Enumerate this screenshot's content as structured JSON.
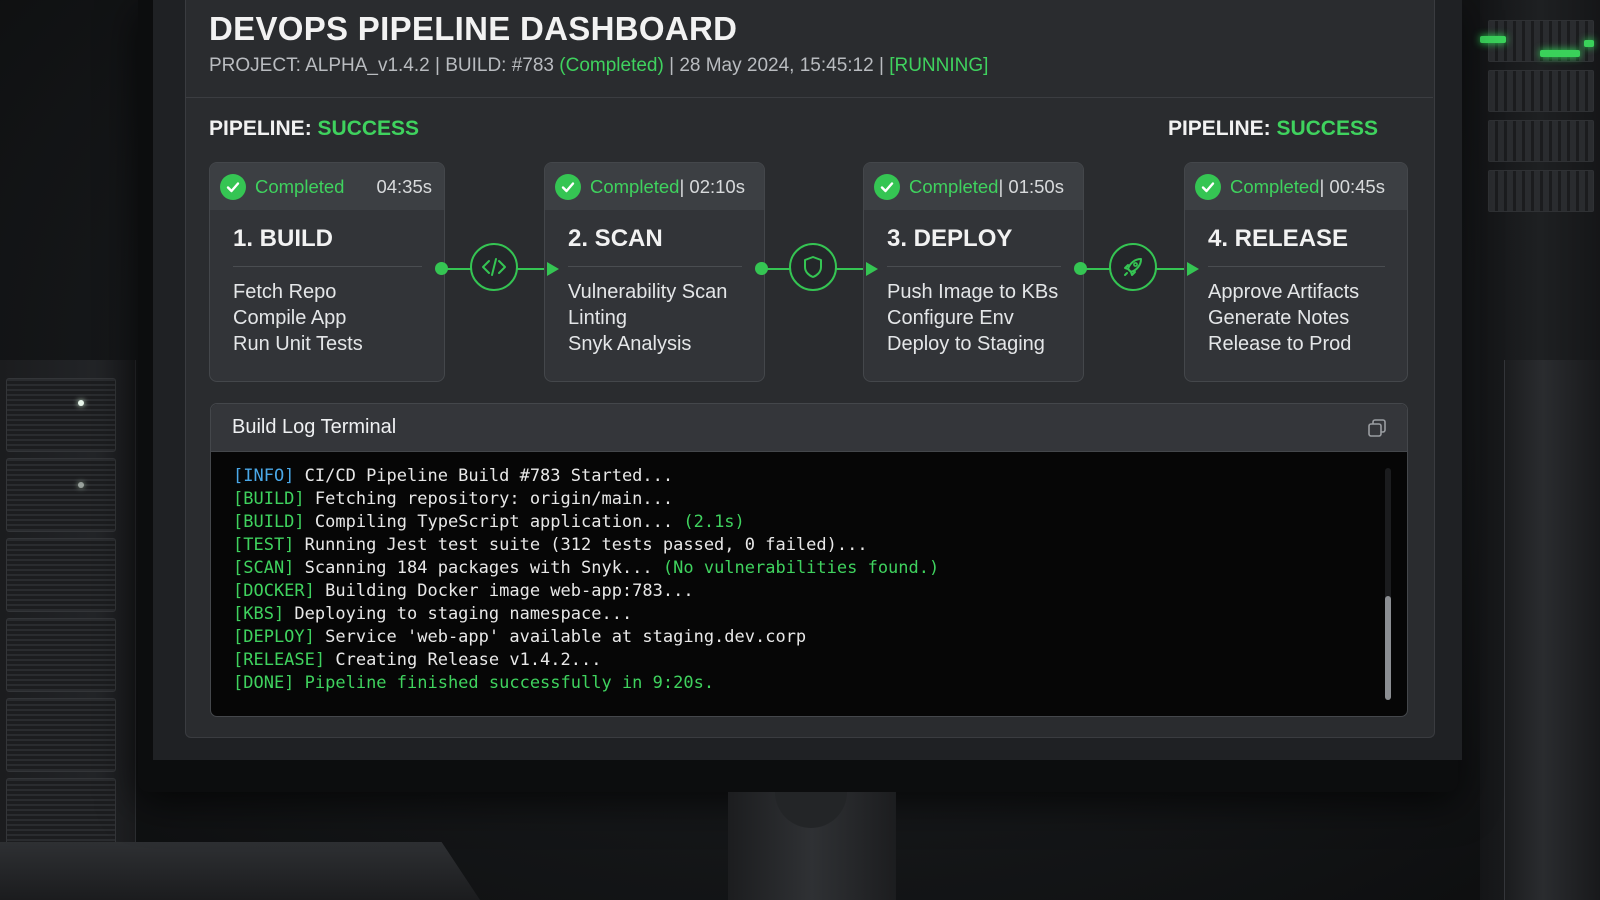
{
  "dashboard": {
    "title": "DEVOPS PIPELINE DASHBOARD",
    "subline": {
      "project": "PROJECT: ALPHA_v1.4.2 | BUILD: #783 ",
      "build_status": "(Completed)",
      "timestamp": " | 28 May 2024, 15:45:12 | ",
      "run_state": "[RUNNING]"
    },
    "pipeline_status_left": {
      "label": "PIPELINE: ",
      "value": "SUCCESS"
    },
    "pipeline_status_right": {
      "label": "PIPELINE: ",
      "value": "SUCCESS"
    }
  },
  "stages": [
    {
      "status": "Completed",
      "duration": "04:35s",
      "name": "1. BUILD",
      "tasks": [
        "Fetch Repo",
        "Compile App",
        "Run Unit Tests"
      ]
    },
    {
      "status": "Completed",
      "duration": " | 02:10s",
      "name": "2. SCAN",
      "tasks": [
        "Vulnerability Scan",
        "Linting",
        "Snyk Analysis"
      ]
    },
    {
      "status": "Completed",
      "duration": " | 01:50s",
      "name": "3. DEPLOY",
      "tasks": [
        "Push Image to KBs",
        "Configure Env",
        "Deploy to Staging"
      ]
    },
    {
      "status": "Completed",
      "duration": " | 00:45s",
      "name": "4. RELEASE",
      "tasks": [
        "Approve Artifacts",
        "Generate Notes",
        "Release to Prod"
      ]
    }
  ],
  "connectors": [
    {
      "icon": "code-icon"
    },
    {
      "icon": "shield-icon"
    },
    {
      "icon": "rocket-icon"
    }
  ],
  "terminal": {
    "title": "Build Log Terminal",
    "copy_icon": "copy-icon",
    "lines": [
      {
        "tag": "[INFO]",
        "text": " CI/CD Pipeline Build #783 Started...",
        "extra": ""
      },
      {
        "tag": "[BUILD]",
        "text": " Fetching repository: origin/main...",
        "extra": ""
      },
      {
        "tag": "[BUILD]",
        "text": " Compiling TypeScript application... ",
        "extra": "(2.1s)"
      },
      {
        "tag": "[TEST]",
        "text": " Running Jest test suite (312 tests passed, 0 failed)...",
        "extra": ""
      },
      {
        "tag": "[SCAN]",
        "text": " Scanning 184 packages with Snyk... ",
        "extra": "(No vulnerabilities found.)"
      },
      {
        "tag": "[DOCKER]",
        "text": " Building Docker image web-app:783...",
        "extra": ""
      },
      {
        "tag": "[KBS]",
        "text": " Deploying to staging namespace...",
        "extra": ""
      },
      {
        "tag": "[DEPLOY]",
        "text": " Service 'web-app' available at staging.dev.corp",
        "extra": ""
      },
      {
        "tag": "[RELEASE]",
        "text": " Creating Release v1.4.2...",
        "extra": ""
      },
      {
        "tag": "[DONE]",
        "text": "",
        "extra": " Pipeline finished successfully in 9:20s."
      }
    ]
  },
  "colors": {
    "accent_green": "#3fd25e",
    "info_blue": "#4aa8e8",
    "panel_bg": "#2a2c2f",
    "terminal_bg": "#060606"
  }
}
